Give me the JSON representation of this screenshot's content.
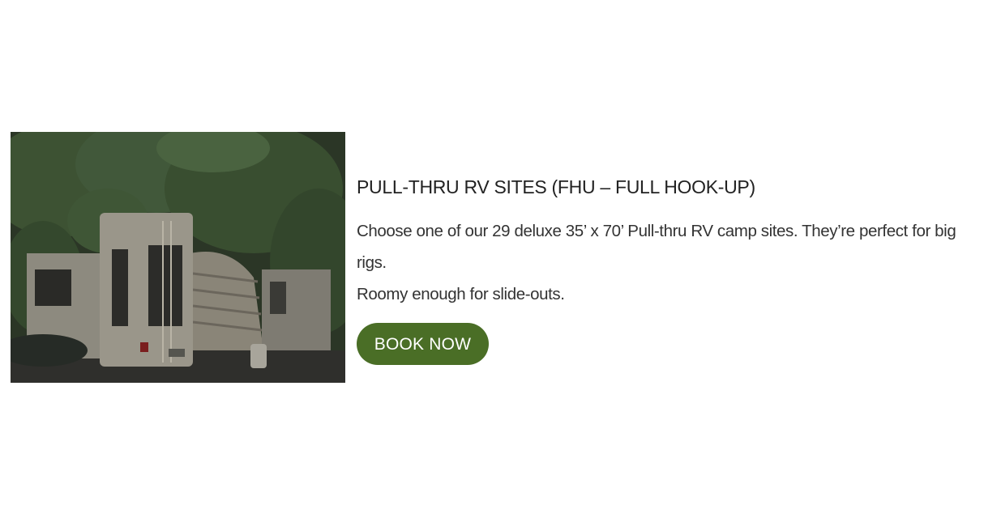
{
  "card": {
    "image_alt": "RV campers parked under trees",
    "title": "PULL-THRU RV SITES (FHU – FULL HOOK-UP)",
    "description_line1": "Choose one of our 29 deluxe 35’ x 70’ Pull-thru RV camp sites. They’re perfect for big rigs.",
    "description_line2": "Roomy enough for slide-outs.",
    "button_label": "BOOK NOW"
  },
  "colors": {
    "button_bg": "#4a6e26",
    "button_text": "#ffffff",
    "title_text": "#222222",
    "body_text": "#333333"
  }
}
